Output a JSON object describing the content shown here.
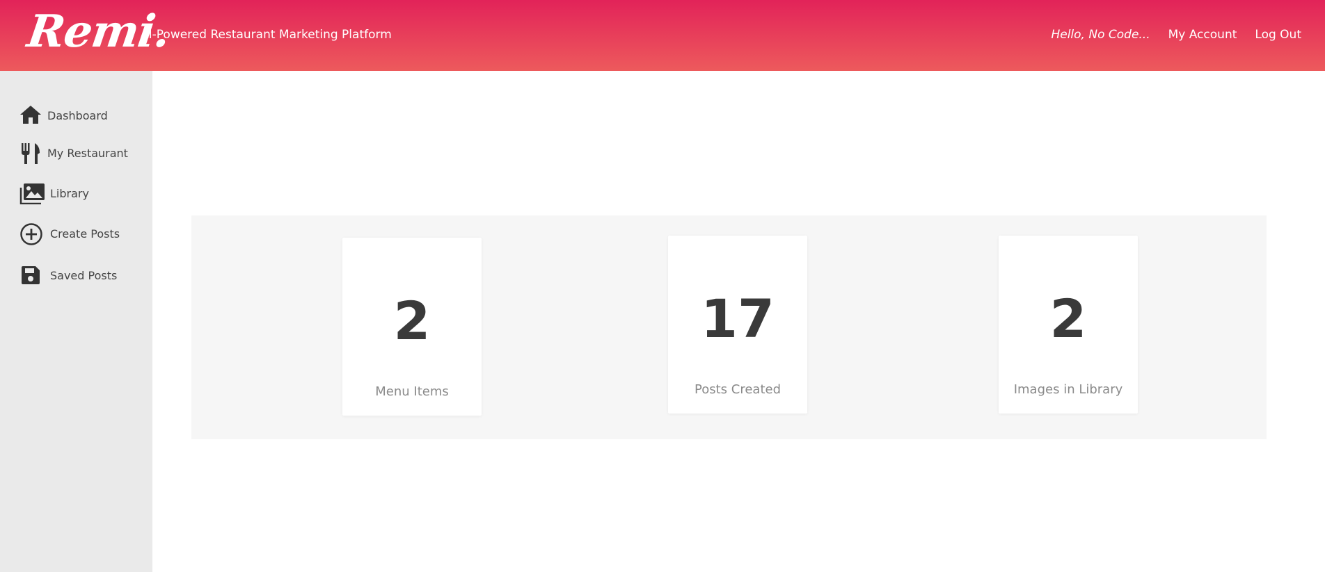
{
  "header": {
    "logo": "Remi.",
    "tagline": "AI-Powered Restaurant Marketing Platform",
    "greeting": "Hello, No Code...",
    "my_account": "My Account",
    "log_out": "Log Out",
    "gradient_top": "#e22359",
    "gradient_bottom": "#ed5a5c"
  },
  "sidebar": {
    "items": [
      {
        "label": "Dashboard",
        "icon": "home-icon"
      },
      {
        "label": "My Restaurant",
        "icon": "utensils-icon"
      },
      {
        "label": "Library",
        "icon": "images-icon"
      },
      {
        "label": "Create Posts",
        "icon": "plus-circle-icon"
      },
      {
        "label": "Saved Posts",
        "icon": "floppy-disk-icon"
      }
    ]
  },
  "stats": [
    {
      "value": "2",
      "label": "Menu Items"
    },
    {
      "value": "17",
      "label": "Posts Created"
    },
    {
      "value": "2",
      "label": "Images in Library"
    }
  ]
}
